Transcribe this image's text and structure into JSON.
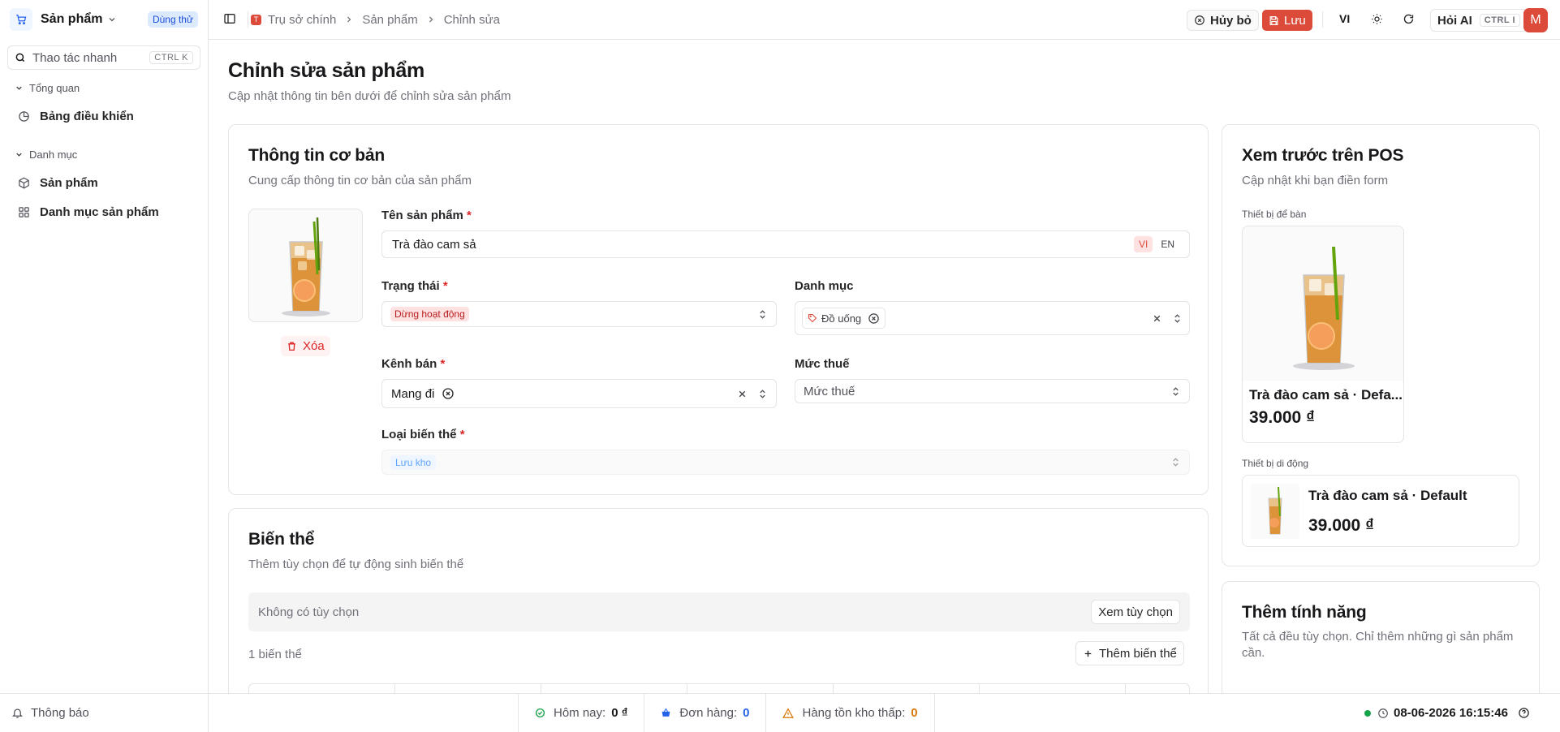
{
  "sidebar": {
    "app_title": "Sản phẩm",
    "trial_badge": "Dùng thử",
    "search_placeholder": "Thao tác nhanh",
    "search_shortcut": "CTRL K",
    "groups": [
      {
        "label": "Tổng quan",
        "items": [
          {
            "label": "Bảng điều khiển",
            "icon": "dashboard-icon"
          }
        ]
      },
      {
        "label": "Danh mục",
        "items": [
          {
            "label": "Sản phẩm",
            "icon": "box-icon"
          },
          {
            "label": "Danh mục sản phẩm",
            "icon": "grid-icon"
          }
        ]
      }
    ]
  },
  "topbar": {
    "breadcrumb": [
      "Trụ sở chính",
      "Sản phẩm",
      "Chỉnh sửa"
    ],
    "store_initial": "T",
    "cancel_label": "Hủy bỏ",
    "save_label": "Lưu",
    "language": "VI",
    "ask_ai_label": "Hỏi AI",
    "ask_ai_shortcut": "CTRL I",
    "avatar_initial": "M"
  },
  "page": {
    "title": "Chỉnh sửa sản phẩm",
    "subtitle": "Cập nhật thông tin bên dưới để chỉnh sửa sản phẩm"
  },
  "basic_info": {
    "title": "Thông tin cơ bản",
    "subtitle": "Cung cấp thông tin cơ bản của sản phẩm",
    "delete_image_label": "Xóa",
    "name_label": "Tên sản phẩm",
    "name_value": "Trà đào cam sả",
    "lang_vi": "VI",
    "lang_en": "EN",
    "status_label": "Trạng thái",
    "status_value": "Dừng hoạt động",
    "category_label": "Danh mục",
    "category_value": "Đồ uống",
    "channel_label": "Kênh bán",
    "channel_value": "Mang đi",
    "tax_label": "Mức thuế",
    "tax_placeholder": "Mức thuế",
    "variant_type_label": "Loại biến thể",
    "variant_type_value": "Lưu kho",
    "required_mark": "*"
  },
  "variants": {
    "title": "Biến thể",
    "subtitle": "Thêm tùy chọn để tự động sinh biến thể",
    "no_options": "Không có tùy chọn",
    "view_options_label": "Xem tùy chọn",
    "count_label": "1 biến thể",
    "add_variant_label": "Thêm biến thể"
  },
  "preview": {
    "title": "Xem trước trên POS",
    "subtitle": "Cập nhật khi bạn điền form",
    "desktop_label": "Thiết bị để bàn",
    "mobile_label": "Thiết bị di động",
    "desktop_name": "Trà đào cam sả · Defa...",
    "mobile_name": "Trà đào cam sả · Default",
    "price": "39.000 ₫"
  },
  "features": {
    "title": "Thêm tính năng",
    "subtitle": "Tất cả đều tùy chọn. Chỉ thêm những gì sản phẩm cần."
  },
  "statusbar": {
    "notifications_label": "Thông báo",
    "today_label": "Hôm nay:",
    "today_value": "0 ₫",
    "orders_label": "Đơn hàng:",
    "orders_value": "0",
    "low_stock_label": "Hàng tồn kho thấp:",
    "low_stock_value": "0",
    "datetime": "08-06-2026 16:15:46"
  },
  "colors": {
    "accent": "#dc4b3a",
    "brand_blue": "#2563eb",
    "online_dot": "#16a34a",
    "warning": "#d97706"
  }
}
